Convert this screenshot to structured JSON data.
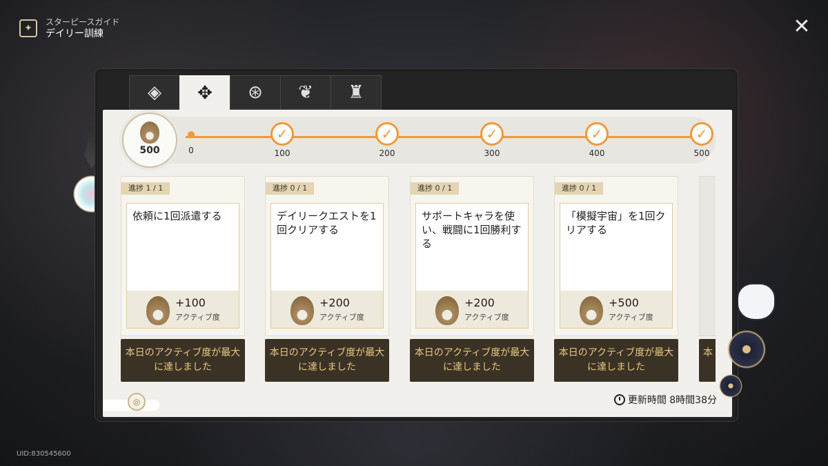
{
  "header": {
    "subtitle": "スターピースガイド",
    "title": "デイリー訓練"
  },
  "close_label": "✕",
  "uid": "UID:830545600",
  "tabs": [
    {
      "icon": "stacked-diamond-icon",
      "glyph": "◈"
    },
    {
      "icon": "compass-cross-icon",
      "glyph": "✥"
    },
    {
      "icon": "triangle-ring-icon",
      "glyph": "⊛"
    },
    {
      "icon": "fan-emblem-icon",
      "glyph": "❦"
    },
    {
      "icon": "tower-emblem-icon",
      "glyph": "♜"
    }
  ],
  "progress": {
    "current_points": "500",
    "start_label": "0",
    "milestones": [
      "100",
      "200",
      "300",
      "400",
      "500"
    ],
    "accent_color": "#f0993a"
  },
  "cards": [
    {
      "progress": "進捗  1 / 1",
      "title": "依頼に1回派遣する",
      "reward": "+100",
      "reward_unit": "アクティブ度",
      "status": "本日のアクティブ度が最大に達しました"
    },
    {
      "progress": "進捗  0 / 1",
      "title": "デイリークエストを1回クリアする",
      "reward": "+200",
      "reward_unit": "アクティブ度",
      "status": "本日のアクティブ度が最大に達しました"
    },
    {
      "progress": "進捗  0 / 1",
      "title": "サポートキャラを使い、戦闘に1回勝利する",
      "reward": "+200",
      "reward_unit": "アクティブ度",
      "status": "本日のアクティブ度が最大に達しました"
    },
    {
      "progress": "進捗  0 / 1",
      "title": "「模擬宇宙」を1回クリアする",
      "reward": "+500",
      "reward_unit": "アクティブ度",
      "status": "本日のアクティブ度が最大に達しました"
    }
  ],
  "partial_card": {
    "status_fragment": "本"
  },
  "refresh": {
    "label": "更新時間 8時間38分"
  },
  "colors": {
    "status_bg": "#3b3226",
    "status_text": "#e7c880",
    "tag_bg": "#e3d5b3"
  }
}
